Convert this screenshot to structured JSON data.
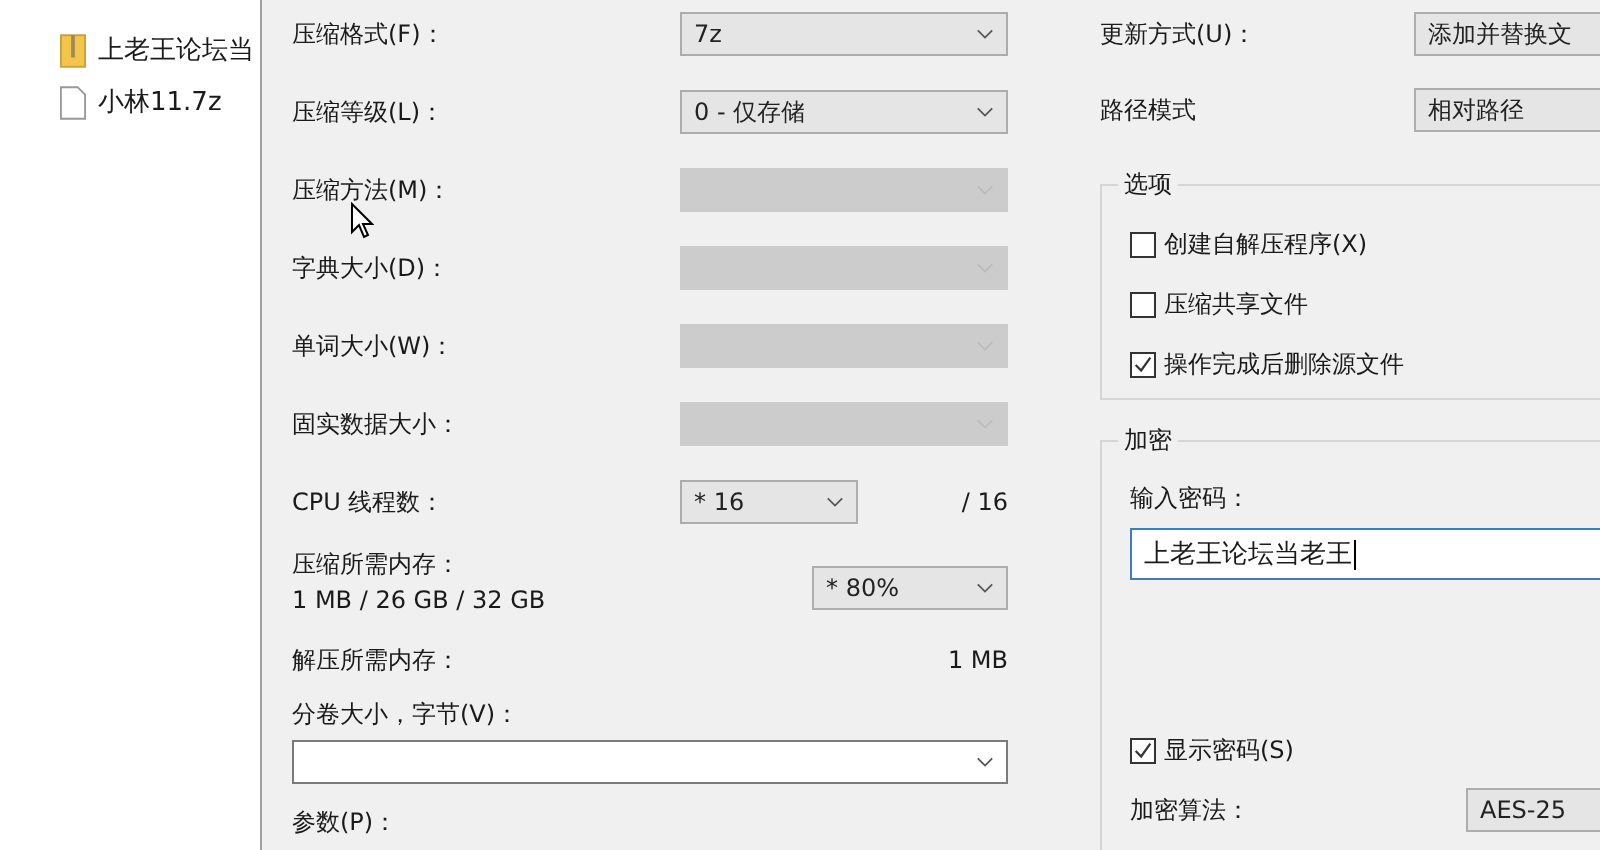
{
  "explorer": {
    "files": [
      {
        "kind": "archive",
        "name": "上老王论坛当"
      },
      {
        "kind": "file",
        "name": "小林11.7z"
      }
    ]
  },
  "compression": {
    "rows": [
      {
        "kind": "select",
        "label": "压缩格式(F)：",
        "value": "7z",
        "disabled": false
      },
      {
        "kind": "select",
        "label": "压缩等级(L)：",
        "value": "0 - 仅存储",
        "disabled": false
      },
      {
        "kind": "select",
        "label": "压缩方法(M)：",
        "disabled": true
      },
      {
        "kind": "select",
        "label": "字典大小(D)：",
        "disabled": true
      },
      {
        "kind": "select",
        "label": "单词大小(W)：",
        "disabled": true
      },
      {
        "kind": "select",
        "label": "固实数据大小：",
        "disabled": true
      },
      {
        "kind": "threads",
        "label": "CPU 线程数：",
        "value": "* 16",
        "note": "/ 16"
      },
      {
        "kind": "memory",
        "label": "压缩所需内存：",
        "sublabel": "1 MB / 26 GB / 32 GB",
        "value": "* 80%"
      },
      {
        "kind": "readout",
        "label": "解压所需内存：",
        "value": "1 MB"
      },
      {
        "kind": "combo",
        "label": "分卷大小，字节(V)："
      },
      {
        "kind": "label",
        "label": "参数(P)："
      }
    ]
  },
  "settings": {
    "rows": [
      {
        "label": "更新方式(U)：",
        "value": "添加并替换文"
      },
      {
        "label": "路径模式",
        "value": "相对路径"
      }
    ]
  },
  "options": {
    "title": "选项",
    "checkboxes": [
      {
        "label": "创建自解压程序(X)",
        "checked": false
      },
      {
        "label": "压缩共享文件",
        "checked": false
      },
      {
        "label": "操作完成后删除源文件",
        "checked": true
      }
    ]
  },
  "encryption": {
    "title": "加密",
    "password_label": "输入密码：",
    "password": "上老王论坛当老王",
    "show_password": {
      "label": "显示密码(S)",
      "checked": true
    },
    "method_label": "加密算法：",
    "method": "AES-25"
  }
}
